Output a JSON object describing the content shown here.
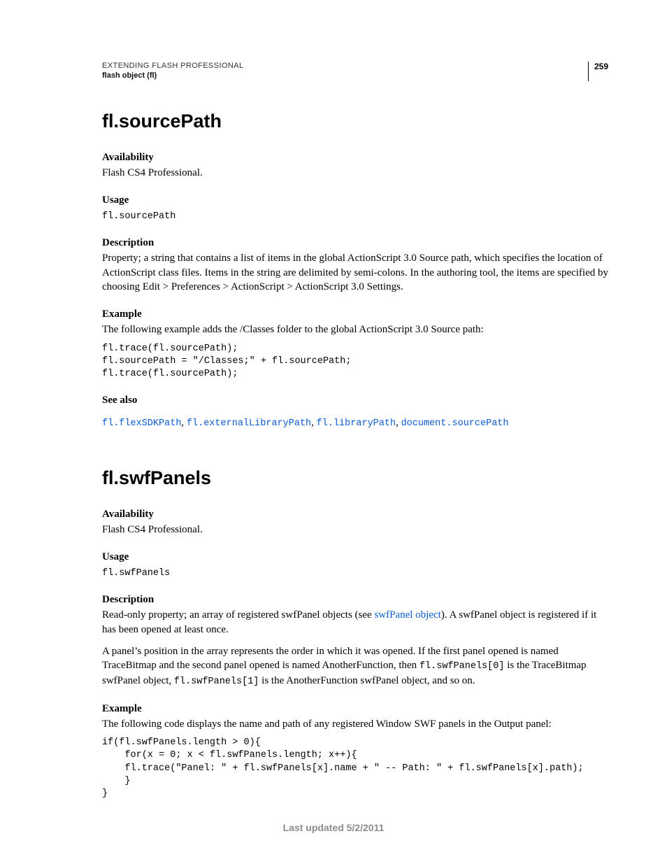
{
  "header": {
    "running_title": "EXTENDING FLASH PROFESSIONAL",
    "running_sub": "flash object (fl)",
    "page_number": "259"
  },
  "sec1": {
    "title": "fl.sourcePath",
    "availability_label": "Availability",
    "availability_text": "Flash CS4 Professional.",
    "usage_label": "Usage",
    "usage_code": "fl.sourcePath",
    "description_label": "Description",
    "description_text": "Property; a string that contains a list of items in the global ActionScript 3.0 Source path, which specifies the location of ActionScript class files. Items in the string are delimited by semi-colons. In the authoring tool, the items are specified by choosing Edit > Preferences > ActionScript > ActionScript 3.0 Settings.",
    "example_label": "Example",
    "example_intro": "The following example adds the /Classes folder to the global ActionScript 3.0 Source path:",
    "example_code": "fl.trace(fl.sourcePath);\nfl.sourcePath = \"/Classes;\" + fl.sourcePath;\nfl.trace(fl.sourcePath);",
    "seealso_label": "See also",
    "seealso_links": {
      "a": "fl.flexSDKPath",
      "b": "fl.externalLibraryPath",
      "c": "fl.libraryPath",
      "d": "document.sourcePath"
    }
  },
  "sec2": {
    "title": "fl.swfPanels",
    "availability_label": "Availability",
    "availability_text": "Flash CS4 Professional.",
    "usage_label": "Usage",
    "usage_code": "fl.swfPanels",
    "description_label": "Description",
    "description_p1_pre": "Read-only property; an array of registered swfPanel objects (see ",
    "description_p1_link": "swfPanel object",
    "description_p1_post": "). A swfPanel object is registered if it has been opened at least once.",
    "description_p2_pre": "A panel’s position in the array represents the order in which it was opened. If the first panel opened is named TraceBitmap and the second panel opened is named AnotherFunction, then ",
    "description_p2_code1": "fl.swfPanels[0]",
    "description_p2_mid": " is the TraceBitmap swfPanel object, ",
    "description_p2_code2": "fl.swfPanels[1]",
    "description_p2_post": " is the AnotherFunction swfPanel object, and so on.",
    "example_label": "Example",
    "example_intro": "The following code displays the name and path of any registered Window SWF panels in the Output panel:",
    "example_code": "if(fl.swfPanels.length > 0){\n    for(x = 0; x < fl.swfPanels.length; x++){\n    fl.trace(\"Panel: \" + fl.swfPanels[x].name + \" -- Path: \" + fl.swfPanels[x].path);\n    }\n}"
  },
  "footer": {
    "updated": "Last updated 5/2/2011"
  }
}
